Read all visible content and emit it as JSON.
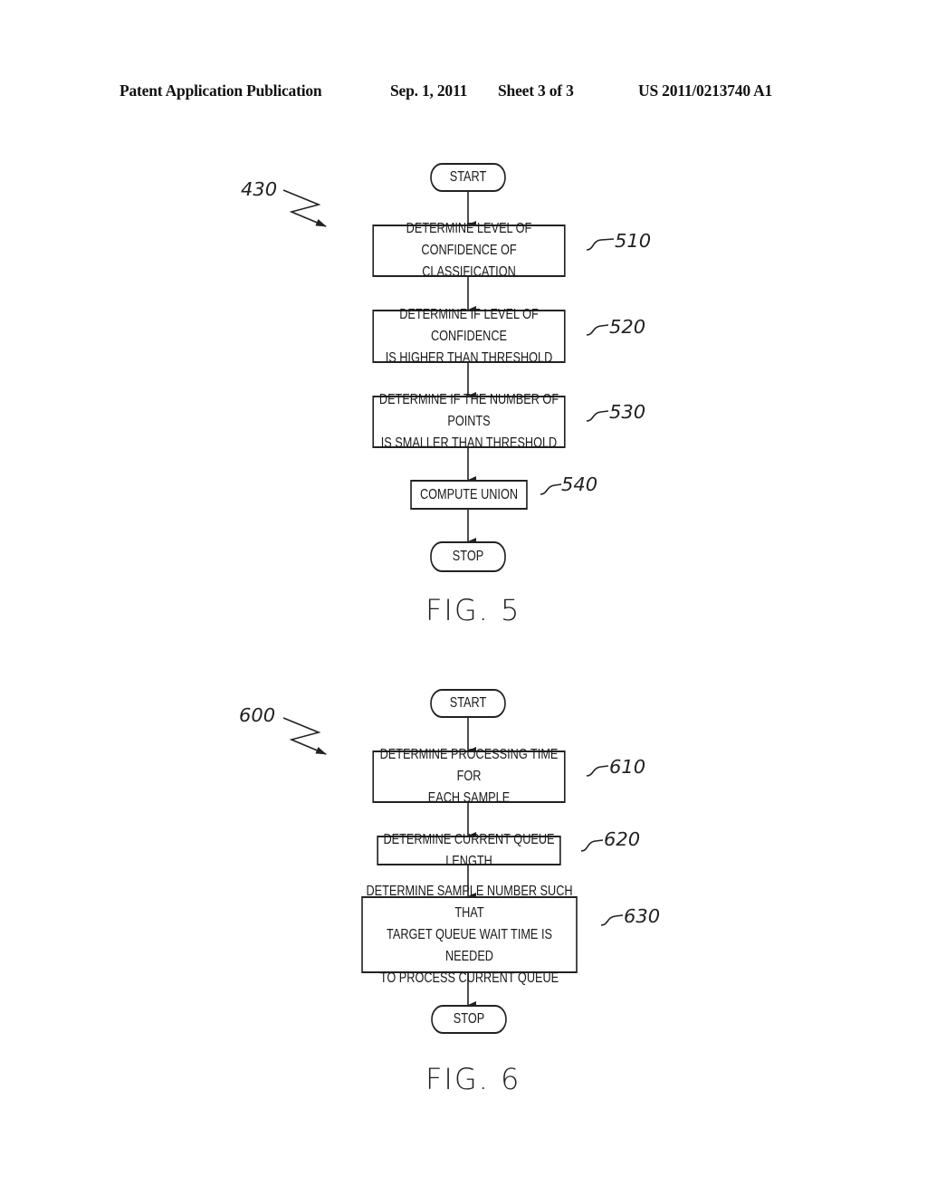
{
  "header": {
    "publication": "Patent Application Publication",
    "date": "Sep. 1, 2011",
    "sheet": "Sheet 3 of 3",
    "number": "US 2011/0213740 A1"
  },
  "fig5": {
    "ref": "430",
    "start": "START",
    "steps": [
      {
        "ref": "510",
        "text": "DETERMINE LEVEL OF\nCONFIDENCE OF CLASSIFICATION"
      },
      {
        "ref": "520",
        "text": "DETERMINE IF LEVEL OF CONFIDENCE\nIS HIGHER THAN THRESHOLD"
      },
      {
        "ref": "530",
        "text": "DETERMINE IF THE NUMBER OF POINTS\nIS SMALLER THAN THRESHOLD"
      },
      {
        "ref": "540",
        "text": "COMPUTE UNION"
      }
    ],
    "stop": "STOP",
    "caption": "FIG. 5"
  },
  "fig6": {
    "ref": "600",
    "start": "START",
    "steps": [
      {
        "ref": "610",
        "text": "DETERMINE PROCESSING TIME FOR\nEACH SAMPLE"
      },
      {
        "ref": "620",
        "text": "DETERMINE CURRENT QUEUE LENGTH"
      },
      {
        "ref": "630",
        "text": "DETERMINE SAMPLE NUMBER SUCH THAT\nTARGET QUEUE WAIT TIME IS NEEDED\nTO PROCESS CURRENT QUEUE"
      }
    ],
    "stop": "STOP",
    "caption": "FIG. 6"
  }
}
